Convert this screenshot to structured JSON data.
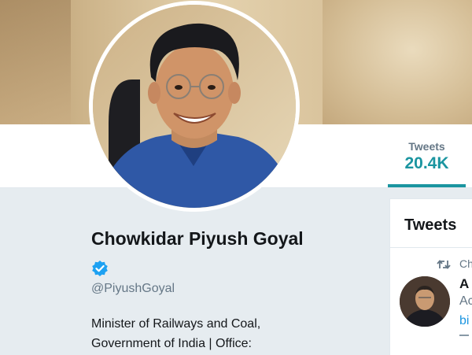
{
  "profile": {
    "name": "Chowkidar Piyush Goyal",
    "handle": "@PiyushGoyal",
    "verified_icon": "verified-badge-icon",
    "bio_lines": [
      "Minister of Railways and Coal,",
      "Government of India | Office:"
    ]
  },
  "nav": {
    "tweets_label": "Tweets",
    "tweets_count": "20.4K"
  },
  "tweets_panel": {
    "title": "Tweets",
    "retweet_icon": "retweet-icon",
    "retweet_context": "Ch",
    "tweet": {
      "author": "A",
      "line2": "Ac",
      "line3": "bi"
    }
  },
  "colors": {
    "accent": "#1b95a0",
    "verified": "#1da1f2",
    "text_secondary": "#657786",
    "page_bg": "#e6ecf0"
  }
}
